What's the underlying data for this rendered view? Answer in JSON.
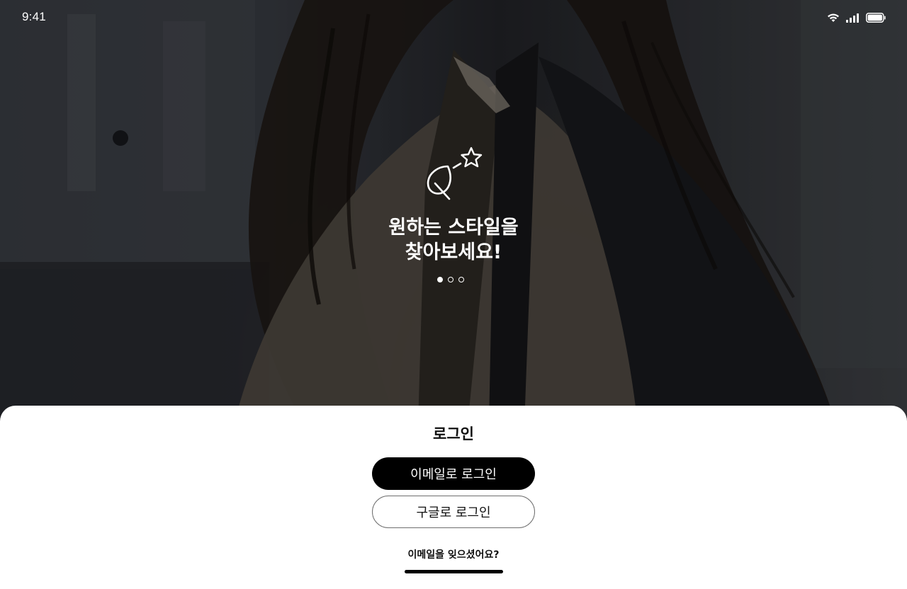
{
  "status_bar": {
    "time": "9:41",
    "icons": [
      "wifi-icon",
      "cellular-signal-icon",
      "battery-icon"
    ]
  },
  "hero": {
    "background": "photo of a person with long dark hair wearing a jacket (darkened)",
    "icon": "leaf-star-icon",
    "title_line1": "원하는 스타일을",
    "title_line2": "찾아보세요!",
    "pager": {
      "page_count": 3,
      "active_index": 0
    }
  },
  "login_sheet": {
    "title": "로그인",
    "email_login_label": "이메일로 로그인",
    "google_login_label": "구글로 로그인",
    "forgot_email_label": "이메일을 잊으셨어요?"
  },
  "colors": {
    "primary_button_bg": "#000000",
    "primary_button_text": "#ffffff",
    "secondary_button_border": "#6e6e6e",
    "sheet_bg": "#ffffff",
    "hero_text": "#ffffff"
  }
}
